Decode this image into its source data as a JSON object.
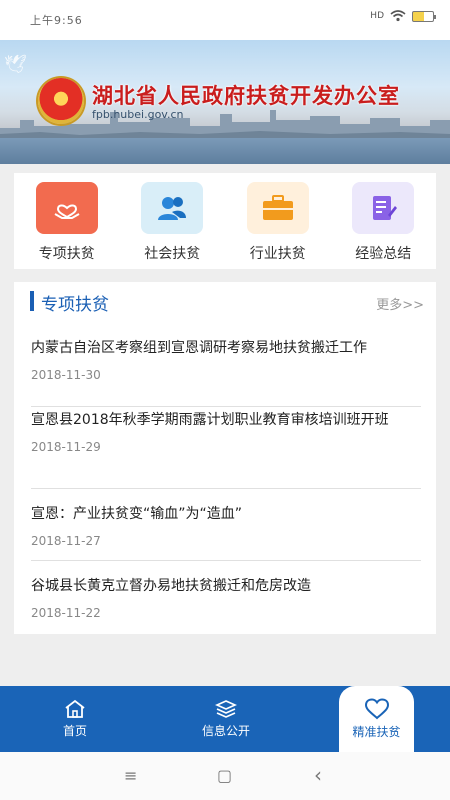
{
  "status_bar": {
    "time": "上午9:56",
    "signal": "HD",
    "icons": [
      "signal-icon",
      "wifi-icon",
      "battery-icon"
    ]
  },
  "banner": {
    "title": "湖北省人民政府扶贫开发办公室",
    "url": "fpb.hubei.gov.cn"
  },
  "categories": [
    {
      "label": "专项扶贫",
      "icon": "heart-hand-icon",
      "color": "#f26b4f"
    },
    {
      "label": "社会扶贫",
      "icon": "people-icon",
      "color": "#d9eef8"
    },
    {
      "label": "行业扶贫",
      "icon": "briefcase-icon",
      "color": "#fff0dc"
    },
    {
      "label": "经验总结",
      "icon": "notes-icon",
      "color": "#ece8fb"
    }
  ],
  "news": {
    "section_title": "专项扶贫",
    "more_label": "更多>>",
    "items": [
      {
        "title": "内蒙古自治区考察组到宣恩调研考察易地扶贫搬迁工作",
        "date": "2018-11-30"
      },
      {
        "title": "宣恩县2018年秋季学期雨露计划职业教育审核培训班开班",
        "date": "2018-11-29"
      },
      {
        "title": "宣恩：产业扶贫变“输血”为“造血”",
        "date": "2018-11-27"
      },
      {
        "title": "谷城县长黄克立督办易地扶贫搬迁和危房改造",
        "date": "2018-11-22"
      }
    ]
  },
  "tabs": [
    {
      "label": "首页",
      "icon": "home-icon"
    },
    {
      "label": "信息公开",
      "icon": "layers-icon"
    },
    {
      "label": "精准扶贫",
      "icon": "heart-icon",
      "active": true
    }
  ],
  "system_nav": {
    "menu": "≡",
    "home": "▢",
    "back": "‹"
  }
}
